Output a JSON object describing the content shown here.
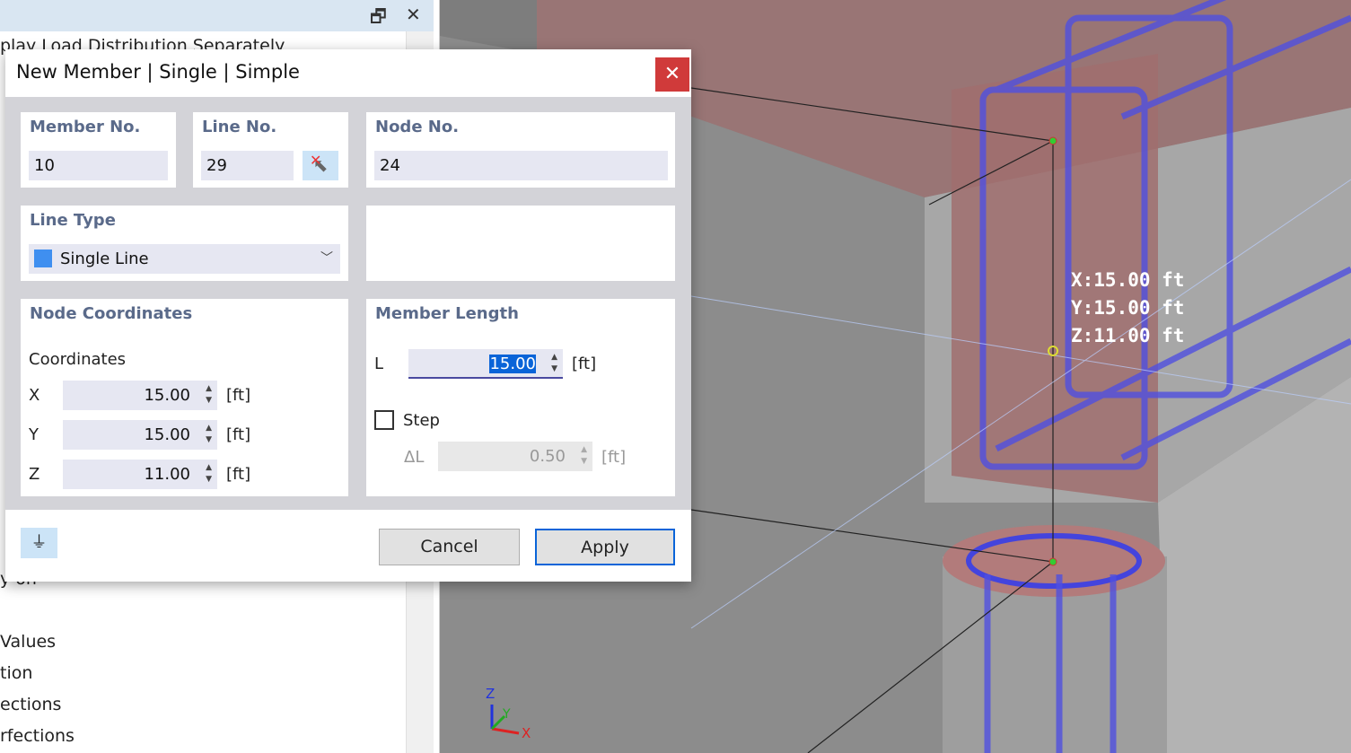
{
  "left_panel": {
    "hidden_header": "play Load Distribution Separately",
    "visible_items": [
      "y on",
      "Values",
      "tion",
      "ections",
      "rfections"
    ]
  },
  "dialog": {
    "title": "New Member | Single | Simple",
    "member_no": {
      "label": "Member No.",
      "value": "10"
    },
    "line_no": {
      "label": "Line No.",
      "value": "29"
    },
    "node_no": {
      "label": "Node No.",
      "value": "24"
    },
    "line_type": {
      "label": "Line Type",
      "value": "Single Line",
      "color": "#3f8ff0"
    },
    "node_coordinates": {
      "label": "Node Coordinates",
      "sublabel": "Coordinates",
      "rows": [
        {
          "axis": "X",
          "value": "15.00",
          "unit": "[ft]"
        },
        {
          "axis": "Y",
          "value": "15.00",
          "unit": "[ft]"
        },
        {
          "axis": "Z",
          "value": "11.00",
          "unit": "[ft]"
        }
      ]
    },
    "member_length": {
      "label": "Member Length",
      "L_label": "L",
      "L_value": "15.00",
      "L_unit": "[ft]",
      "step_label": "Step",
      "step_checked": false,
      "delta_label": "ΔL",
      "delta_value": "0.50",
      "delta_unit": "[ft]"
    },
    "cancel": "Cancel",
    "apply": "Apply"
  },
  "viewport": {
    "coord_labels": [
      "X:15.00 ft",
      "Y:15.00 ft",
      "Z:11.00 ft"
    ],
    "axes": {
      "x": "X",
      "y": "Y",
      "z": "Z"
    }
  }
}
